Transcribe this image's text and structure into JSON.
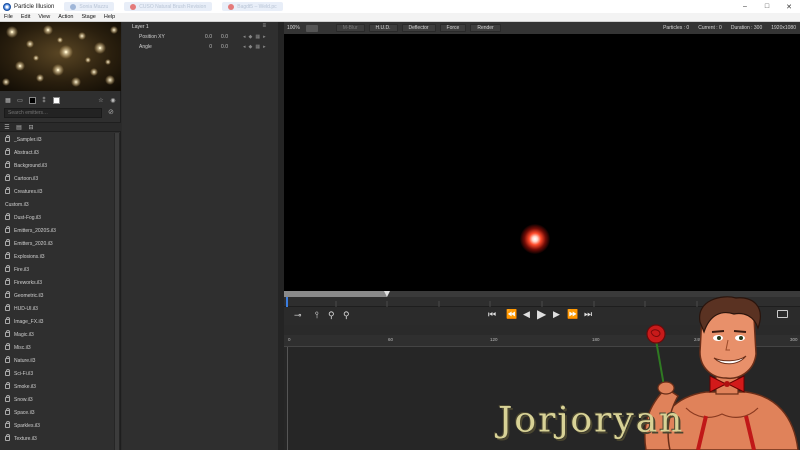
{
  "titlebar": {
    "title": "Particle Illusion",
    "ghost_tabs": [
      "Sonia Mazzu",
      "CUSO Natural Brush Revision",
      "Bagdt5 – Weld.pc"
    ],
    "controls": [
      "–",
      "□",
      "✕"
    ]
  },
  "menu": [
    "File",
    "Edit",
    "View",
    "Action",
    "Stage",
    "Help"
  ],
  "library": {
    "search_placeholder": "Search emitters…",
    "items": [
      {
        "label": "_Sampler.il3",
        "type": "lib"
      },
      {
        "label": "Abstract.il3",
        "type": "lib"
      },
      {
        "label": "Background.il3",
        "type": "lib"
      },
      {
        "label": "Cartoon.il3",
        "type": "lib"
      },
      {
        "label": "Creatures.il3",
        "type": "lib"
      },
      {
        "label": "Custom.il3",
        "type": "folder"
      },
      {
        "label": "Dust-Fog.il3",
        "type": "lib"
      },
      {
        "label": "Emitters_2020S.il3",
        "type": "lib"
      },
      {
        "label": "Emitters_2020.il3",
        "type": "lib"
      },
      {
        "label": "Explosions.il3",
        "type": "lib"
      },
      {
        "label": "Fire.il3",
        "type": "lib"
      },
      {
        "label": "Fireworks.il3",
        "type": "lib"
      },
      {
        "label": "Geometric.il3",
        "type": "lib"
      },
      {
        "label": "HUD-UI.il3",
        "type": "lib"
      },
      {
        "label": "Image_FX.il3",
        "type": "lib"
      },
      {
        "label": "Magic.il3",
        "type": "lib"
      },
      {
        "label": "Misc.il3",
        "type": "lib"
      },
      {
        "label": "Nature.il3",
        "type": "lib"
      },
      {
        "label": "Sci-Fi.il3",
        "type": "lib"
      },
      {
        "label": "Smoke.il3",
        "type": "lib"
      },
      {
        "label": "Snow.il3",
        "type": "lib"
      },
      {
        "label": "Space.il3",
        "type": "lib"
      },
      {
        "label": "Sparkles.il3",
        "type": "lib"
      },
      {
        "label": "Texture.il3",
        "type": "lib"
      }
    ]
  },
  "layer": {
    "name": "Layer 1",
    "properties": [
      {
        "name": "Position XY",
        "v1": "0.0",
        "v2": "0.0"
      },
      {
        "name": "Angle",
        "v1": "0",
        "v2": "0.0"
      }
    ]
  },
  "stage_toolbar": {
    "zoom": "100%",
    "buttons": [
      {
        "label": "M-Blur",
        "dim": true
      },
      {
        "label": "H.U.D.",
        "dim": false
      },
      {
        "label": "Deflector",
        "dim": false
      },
      {
        "label": "Force",
        "dim": false
      },
      {
        "label": "Render",
        "dim": false
      }
    ],
    "particles": "Particles : 0",
    "current": "Current : 0",
    "duration": "Duration : 300",
    "resolution": "1920x1080"
  },
  "timeline": {
    "progress": 0.2,
    "ticks": [
      "0",
      "60",
      "120",
      "180",
      "240",
      "300"
    ]
  },
  "watermark": "Jorjoryan",
  "colors": {
    "accent_blue": "#3b7de0",
    "glow_red": "#ff4a2a",
    "watermark": "#d8d296"
  }
}
